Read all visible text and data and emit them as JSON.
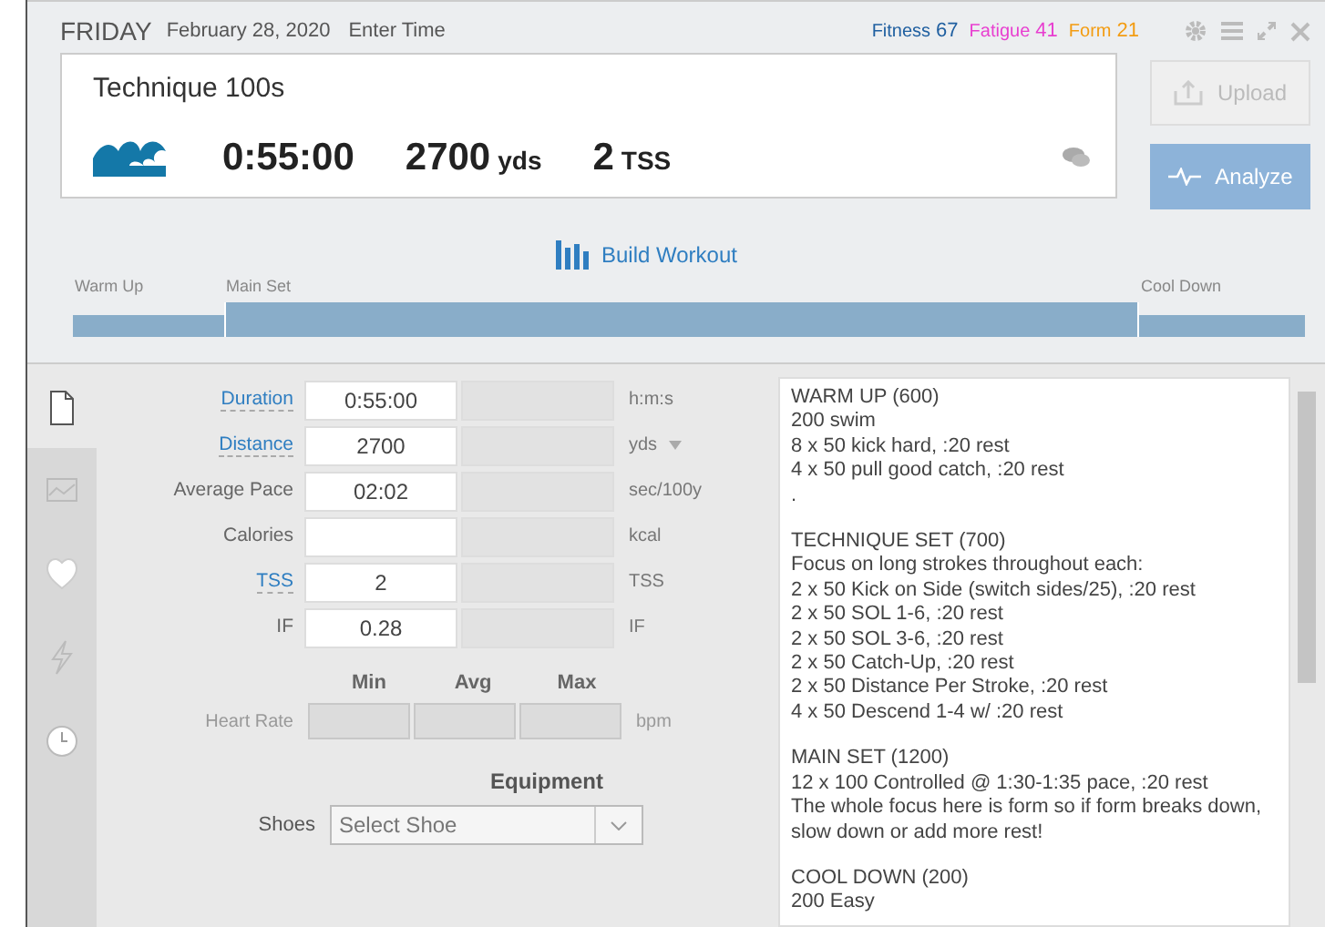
{
  "header": {
    "day": "FRIDAY",
    "date": "February 28, 2020",
    "enter_time": "Enter Time",
    "metrics": [
      {
        "label": "Fitness",
        "value": "67",
        "color": "#1f5fa0"
      },
      {
        "label": "Fatigue",
        "value": "41",
        "color": "#e83ed0"
      },
      {
        "label": "Form",
        "value": "21",
        "color": "#f39c12"
      }
    ]
  },
  "workout": {
    "title": "Technique 100s",
    "duration": "0:55:00",
    "distance": "2700",
    "distance_unit": "yds",
    "tss": "2",
    "tss_unit": "TSS"
  },
  "buttons": [
    {
      "label": "Upload",
      "disabled": true
    },
    {
      "label": "Analyze",
      "disabled": false
    }
  ],
  "build_workout": "Build Workout",
  "phases": [
    {
      "label": "Warm Up"
    },
    {
      "label": "Main Set"
    },
    {
      "label": "Cool Down"
    }
  ],
  "sidebar_tabs": [
    {
      "kind": "document",
      "selected": true
    },
    {
      "kind": "chart",
      "selected": false
    },
    {
      "kind": "heart",
      "selected": false
    },
    {
      "kind": "power",
      "selected": false
    },
    {
      "kind": "clock",
      "selected": false
    }
  ],
  "fields": [
    {
      "label": "Duration",
      "link": true,
      "value": "0:55:00",
      "unit": "h:m:s",
      "dropdown": false
    },
    {
      "label": "Distance",
      "link": true,
      "value": "2700",
      "unit": "yds",
      "dropdown": true
    },
    {
      "label": "Average Pace",
      "link": false,
      "value": "02:02",
      "unit": "sec/100y",
      "dropdown": false
    },
    {
      "label": "Calories",
      "link": false,
      "unit": "kcal",
      "dropdown": false
    },
    {
      "label": "TSS",
      "link": true,
      "value": "2",
      "unit": "TSS",
      "dropdown": false
    },
    {
      "label": "IF",
      "link": false,
      "value": "0.28",
      "unit": "IF",
      "dropdown": false
    }
  ],
  "range_headers": [
    "Min",
    "Avg",
    "Max"
  ],
  "heart_rate": {
    "label": "Heart Rate",
    "unit": "bpm",
    "disabled": true
  },
  "equipment": {
    "title": "Equipment",
    "label": "Shoes",
    "placeholder": "Select Shoe"
  },
  "notes": [
    [
      "WARM UP (600)",
      "200 swim",
      "8 x 50 kick hard, :20 rest",
      "4 x 50 pull good catch, :20 rest",
      "."
    ],
    [
      "TECHNIQUE SET (700)",
      "Focus on long strokes throughout each:",
      "2 x 50 Kick on Side (switch sides/25), :20 rest",
      "2 x 50 SOL 1-6, :20 rest",
      "2 x 50 SOL 3-6, :20 rest",
      "2 x 50 Catch-Up, :20 rest",
      "2 x 50 Distance Per Stroke, :20 rest",
      "4 x 50 Descend 1-4 w/ :20 rest"
    ],
    [
      "MAIN SET (1200)",
      "12 x 100 Controlled @ 1:30-1:35 pace, :20 rest",
      "The whole focus here is form so if form breaks down, slow down or add more rest!"
    ],
    [
      "COOL DOWN (200)",
      "200 Easy"
    ]
  ]
}
